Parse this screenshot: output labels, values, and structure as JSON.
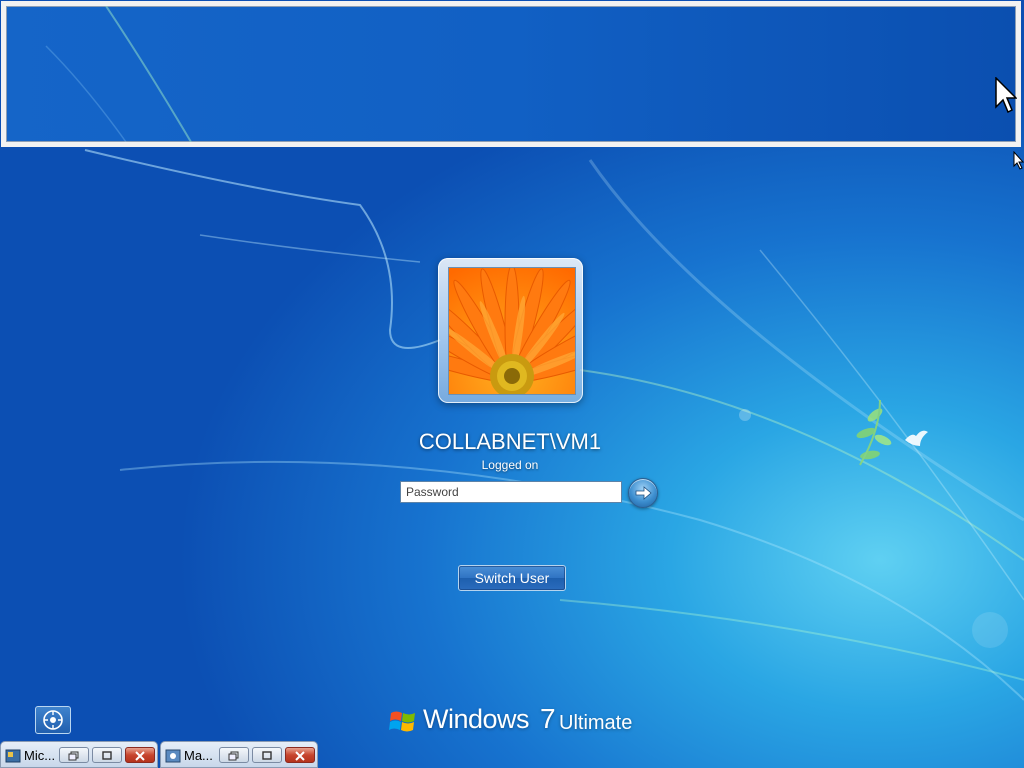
{
  "login": {
    "username": "COLLABNET\\VM1",
    "status": "Logged on",
    "password_placeholder": "Password",
    "switch_user_label": "Switch User"
  },
  "branding": {
    "product": "Windows",
    "version": "7",
    "edition": "Ultimate"
  },
  "minimized_windows": [
    {
      "title": "Mic..."
    },
    {
      "title": "Ma..."
    }
  ],
  "icons": {
    "submit": "arrow-right-icon",
    "ease_of_access": "ease-of-access-icon",
    "logo": "windows-flag-icon"
  },
  "colors": {
    "desktop_dark": "#0c4fb3",
    "desktop_light": "#5fd0f2",
    "close_red": "#c7452e"
  }
}
